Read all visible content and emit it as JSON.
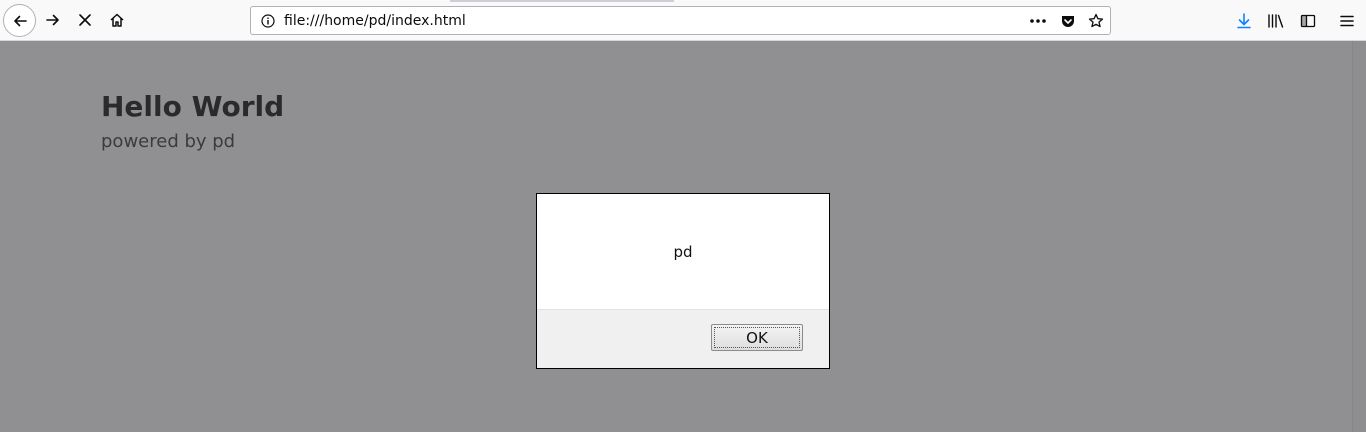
{
  "browser": {
    "url": "file:///home/pd/index.html",
    "icons": {
      "back": "back-arrow-icon",
      "forward": "forward-arrow-icon",
      "stop": "stop-icon",
      "home": "home-icon",
      "info": "info-icon",
      "page_actions": "more-actions-icon",
      "pocket": "pocket-icon",
      "bookmark": "star-icon",
      "downloads": "download-icon",
      "library": "library-icon",
      "sidebar": "sidebar-icon",
      "menu": "hamburger-menu-icon"
    },
    "accent_color": "#0a84ff"
  },
  "page": {
    "title": "Hello World",
    "subtitle": "powered by pd"
  },
  "dialog": {
    "message": "pd",
    "ok_label": "OK"
  }
}
